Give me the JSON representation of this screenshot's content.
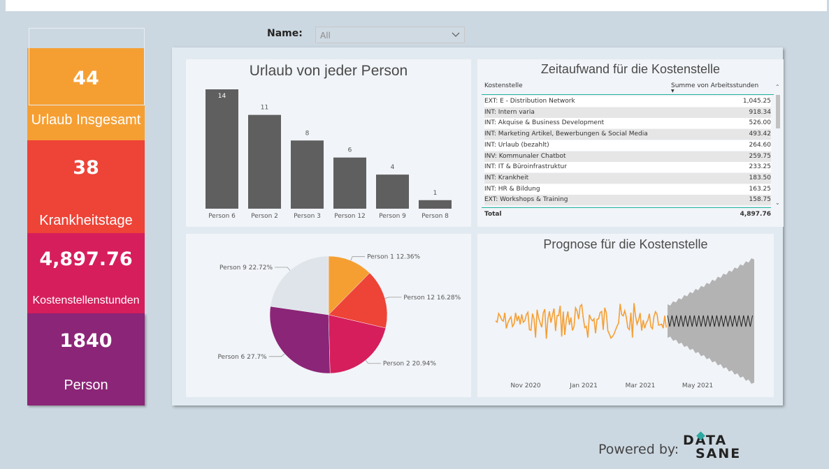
{
  "kpis": [
    {
      "value": "44",
      "label": "Urlaub Insgesamt",
      "color": "#f59f33"
    },
    {
      "value": "38",
      "label": "Krankheitstage",
      "color": "#ee4337"
    },
    {
      "value": "4,897.76",
      "label": "Kostenstellenstunden",
      "color": "#d61e5c"
    },
    {
      "value": "1840",
      "label": "Person",
      "color": "#8b2577"
    }
  ],
  "filter": {
    "label": "Name:",
    "value": "All"
  },
  "bar_panel": {
    "title": "Urlaub von jeder Person"
  },
  "table_panel": {
    "title": "Zeitaufwand für die Kostenstelle",
    "columns": [
      "Kostenstelle",
      "Summe von Arbeitsstunden"
    ],
    "rows": [
      [
        "EXT: E - Distribution Network",
        "1,045.25"
      ],
      [
        "INT: Intern varia",
        "918.34"
      ],
      [
        "INT: Akquise & Business Development",
        "526.00"
      ],
      [
        "INT: Marketing Artikel, Bewerbungen & Social Media",
        "493.42"
      ],
      [
        "INT: Urlaub (bezahlt)",
        "264.60"
      ],
      [
        "INV: Kommunaler Chatbot",
        "259.75"
      ],
      [
        "INT: IT & Büroinfrastruktur",
        "233.25"
      ],
      [
        "INT: Krankheit",
        "183.50"
      ],
      [
        "INT: HR & Bildung",
        "163.25"
      ],
      [
        "EXT: Workshops & Training",
        "158.75"
      ]
    ],
    "total_label": "Total",
    "total_value": "4,897.76"
  },
  "forecast_panel": {
    "title": "Prognose für die Kostenstelle"
  },
  "powered": {
    "text": "Powered by:",
    "logo_line1": "DATA",
    "logo_line2": "SANE"
  },
  "chart_data": [
    {
      "type": "bar",
      "title": "Urlaub von jeder Person",
      "categories": [
        "Person 6",
        "Person 2",
        "Person 3",
        "Person 12",
        "Person 9",
        "Person 8"
      ],
      "values": [
        14,
        11,
        8,
        6,
        4,
        1
      ],
      "color": "#5f5f5f"
    },
    {
      "type": "pie",
      "slices": [
        {
          "label": "Person 1 12.36%",
          "value": 12.36,
          "color": "#f59f33"
        },
        {
          "label": "Person 12 16.28%",
          "value": 16.28,
          "color": "#ee4337"
        },
        {
          "label": "Person 2 20.94%",
          "value": 20.94,
          "color": "#d61e5c"
        },
        {
          "label": "Person 6 27.7%",
          "value": 27.7,
          "color": "#8b2577"
        },
        {
          "label": "Person 9 22.72%",
          "value": 22.72,
          "color": "#dfe4ea"
        }
      ]
    },
    {
      "type": "line",
      "title": "Prognose für die Kostenstelle",
      "x_ticks": [
        "Nov 2020",
        "Jan 2021",
        "Mar 2021",
        "May 2021"
      ],
      "series_color": "#f59f33",
      "forecast_color": "#222222",
      "band_color": "#b3b3b3"
    }
  ]
}
